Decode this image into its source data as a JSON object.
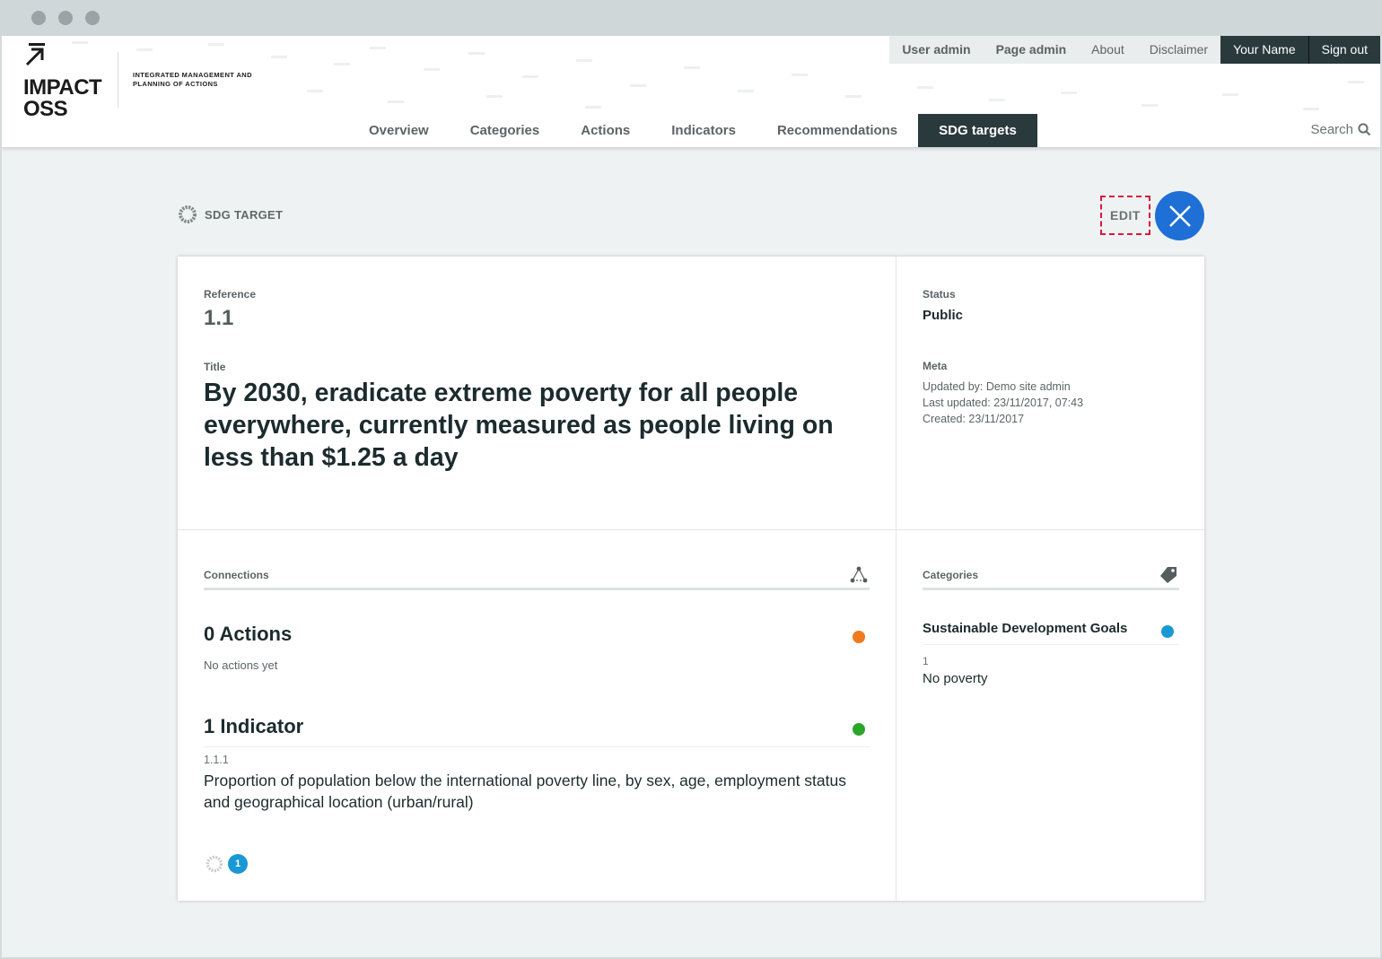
{
  "header": {
    "brand_line1": "IMPACT",
    "brand_line2": "OSS",
    "tagline": "INTEGRATED MANAGEMENT AND PLANNING OF ACTIONS",
    "top_nav": [
      "User admin",
      "Page admin",
      "About",
      "Disclaimer",
      "Your Name",
      "Sign out"
    ],
    "main_nav": [
      "Overview",
      "Categories",
      "Actions",
      "Indicators",
      "Recommendations",
      "SDG targets"
    ],
    "active_tab": "SDG targets",
    "search_label": "Search"
  },
  "page": {
    "section_label": "SDG TARGET",
    "edit_label": "EDIT"
  },
  "details": {
    "reference_label": "Reference",
    "reference_value": "1.1",
    "title_label": "Title",
    "title_value": "By 2030, eradicate extreme poverty for all people everywhere, currently measured as people living on less than $1.25 a day",
    "status_label": "Status",
    "status_value": "Public",
    "meta_label": "Meta",
    "meta_updated_by": "Updated by: Demo site admin",
    "meta_last_updated": "Last updated: 23/11/2017, 07:43",
    "meta_created": "Created: 23/11/2017"
  },
  "connections": {
    "label": "Connections",
    "actions_heading": "0 Actions",
    "actions_empty": "No actions yet",
    "actions_color": "#f07a20",
    "indicators_heading": "1 Indicator",
    "indicators_color": "#2aa52a",
    "indicator": {
      "ref": "1.1.1",
      "title": "Proportion of population below the international poverty line, by sex, age, employment status and geographical location (urban/rural)",
      "badge_count": "1"
    }
  },
  "categories": {
    "label": "Categories",
    "group_name": "Sustainable Development Goals",
    "group_color": "#1a98d6",
    "item_number": "1",
    "item_label": "No poverty"
  },
  "colors": {
    "accent": "#1e6fd6",
    "nav_dark": "#29393c",
    "edit_border": "#d6193f"
  }
}
